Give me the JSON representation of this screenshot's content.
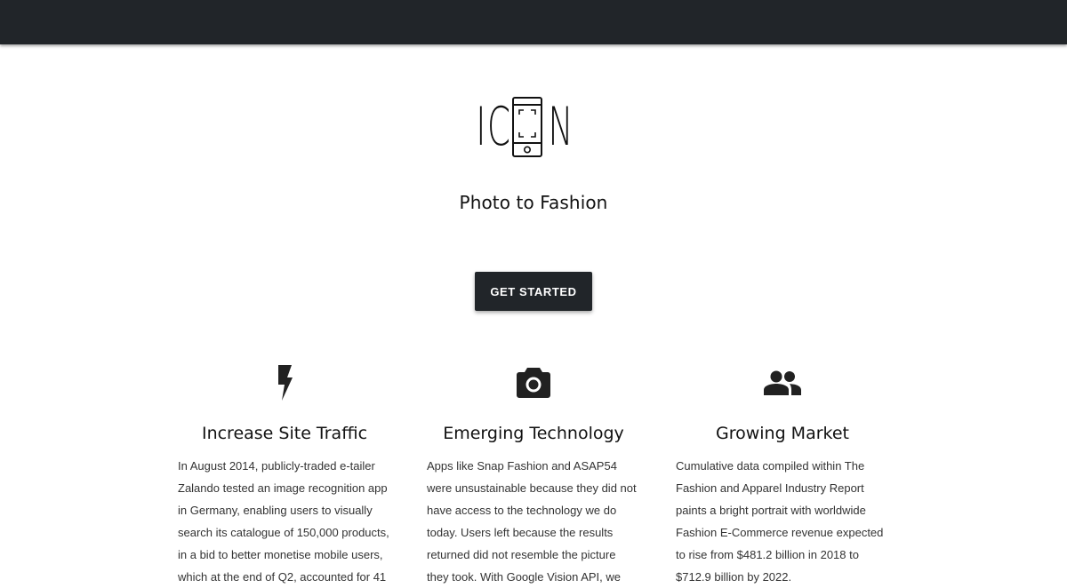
{
  "brand": {
    "logo_letters": [
      "I",
      "C",
      "N"
    ],
    "tagline": "Photo to Fashion"
  },
  "hero": {
    "cta_label": "GET STARTED"
  },
  "features": [
    {
      "icon": "lightning-bolt-icon",
      "title": "Increase Site Traffic",
      "body": "In August 2014, publicly-traded e-tailer Zalando tested an image recognition app in Germany, enabling users to visually search its catalogue of 150,000 products, in a bid to better monetise mobile users, which at the end of Q2, accounted for 41"
    },
    {
      "icon": "camera-icon",
      "title": "Emerging Technology",
      "body": "Apps like Snap Fashion and ASAP54 were unsustainable because they did not have access to the technology we do today. Users left because the results returned did not resemble the picture they took. With Google Vision API, we can deliver"
    },
    {
      "icon": "people-icon",
      "title": "Growing Market",
      "body": "Cumulative data compiled within The Fashion and Apparel Industry Report paints a bright portrait with worldwide Fashion E-Commerce revenue expected to rise from $481.2 billion in 2018 to $712.9 billion by 2022."
    }
  ],
  "colors": {
    "navbar": "#212529",
    "button": "#212529",
    "text": "#111111"
  }
}
